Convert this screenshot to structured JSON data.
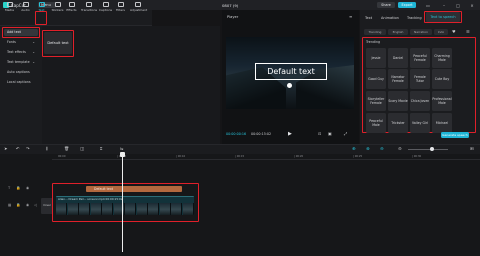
{
  "app": {
    "name": "CapCut",
    "menu_label": "Menu",
    "project_title": "0807 (9)",
    "share_label": "Share",
    "export_label": "Export"
  },
  "toolbar": {
    "items": [
      {
        "label": "Media",
        "icon": "media-icon"
      },
      {
        "label": "Audio",
        "icon": "audio-icon"
      },
      {
        "label": "Text",
        "icon": "text-icon"
      },
      {
        "label": "Stickers",
        "icon": "sticker-icon"
      },
      {
        "label": "Effects",
        "icon": "effects-icon"
      },
      {
        "label": "Transitions",
        "icon": "transitions-icon"
      },
      {
        "label": "Captions",
        "icon": "captions-icon"
      },
      {
        "label": "Filters",
        "icon": "filters-icon"
      },
      {
        "label": "Adjustment",
        "icon": "adjustment-icon"
      }
    ],
    "active": "Text"
  },
  "sidebar": {
    "items": [
      {
        "label": "Add text",
        "selected": true
      },
      {
        "label": "Fonts",
        "chevron": true
      },
      {
        "label": "Text effects",
        "chevron": true
      },
      {
        "label": "Text template",
        "chevron": true
      },
      {
        "label": "Auto captions"
      },
      {
        "label": "Local captions"
      }
    ]
  },
  "gallery": {
    "default_text_card": "Default text"
  },
  "player": {
    "title": "Player",
    "overlay_text": "Default text",
    "current_time": "00:00:00:16",
    "total_time": "00:00:15:02"
  },
  "right_panel": {
    "tabs": [
      "Text",
      "Animation",
      "Tracking",
      "Text to speech"
    ],
    "active_tab": "Text to speech",
    "subtabs": [
      "Trending",
      "English",
      "Narration",
      "Indo"
    ],
    "section_label": "Trending",
    "voices": [
      "Jessie",
      "Daniel",
      "Peaceful Female",
      "Charming Male",
      "Good Guy",
      "Narrator Female",
      "Female Tutor",
      "Cute Boy",
      "Storyteller Female",
      "Scary Movie",
      "Chica Joven",
      "Professional Male",
      "Peaceful Male",
      "Trickster",
      "Valley Girl",
      "Michael"
    ],
    "generate_label": "Generate speech"
  },
  "timeline": {
    "ruler_labels": [
      "00:00",
      "| 00:05",
      "| 00:10",
      "| 00:15",
      "| 00:20",
      "| 00:25",
      "| 00:30"
    ],
    "text_clip_label": "Default text",
    "video_clip_label": "Alien... Dream Pair... screenr.mp4  00:00:15:02",
    "cover_label": "Cover"
  },
  "colors": {
    "accent": "#27c3da",
    "highlight_box": "#e0202a",
    "text_clip": "#b3683e",
    "video_clip": "#12323a"
  }
}
